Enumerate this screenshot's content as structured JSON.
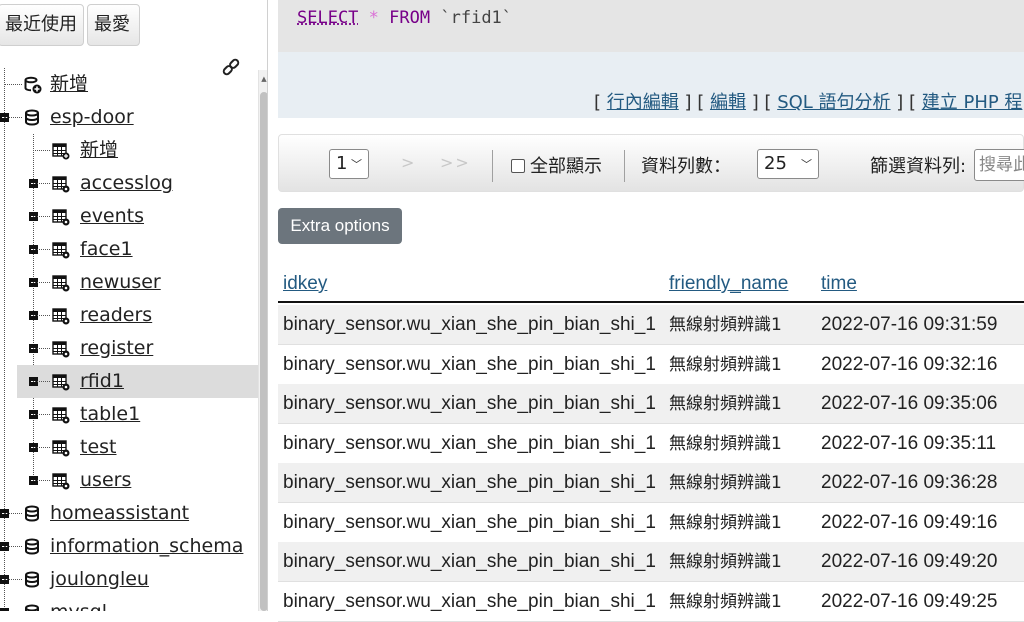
{
  "nav": {
    "recent_label": "最近使用",
    "favorites_label": "最愛",
    "tree": [
      {
        "label": "新增",
        "type": "new-db",
        "level": 0
      },
      {
        "label": "esp-door",
        "type": "db",
        "level": 0,
        "expanded": true
      },
      {
        "label": "新增",
        "type": "new-table",
        "level": 1
      },
      {
        "label": "accesslog",
        "type": "table",
        "level": 1
      },
      {
        "label": "events",
        "type": "table",
        "level": 1
      },
      {
        "label": "face1",
        "type": "table",
        "level": 1
      },
      {
        "label": "newuser",
        "type": "table",
        "level": 1
      },
      {
        "label": "readers",
        "type": "table",
        "level": 1
      },
      {
        "label": "register",
        "type": "table",
        "level": 1
      },
      {
        "label": "rfid1",
        "type": "table",
        "level": 1,
        "selected": true
      },
      {
        "label": "table1",
        "type": "table",
        "level": 1
      },
      {
        "label": "test",
        "type": "table",
        "level": 1
      },
      {
        "label": "users",
        "type": "table",
        "level": 1
      },
      {
        "label": "homeassistant",
        "type": "db",
        "level": 0
      },
      {
        "label": "information_schema",
        "type": "db",
        "level": 0
      },
      {
        "label": "joulongleu",
        "type": "db",
        "level": 0
      },
      {
        "label": "mysql",
        "type": "db",
        "level": 0
      }
    ]
  },
  "sql": {
    "kw_select": "SELECT",
    "star": "*",
    "kw_from": "FROM",
    "table": "`rfid1`",
    "links": {
      "inline_edit": "行內編輯",
      "edit": "編輯",
      "sql_analyze": "SQL 語句分析",
      "create_php": "建立 PHP 程"
    }
  },
  "pager": {
    "page_value": "1",
    "next": ">",
    "last": ">>",
    "show_all": "全部顯示",
    "rows_label": "資料列數：",
    "rows_value": "25",
    "filter_label": "篩選資料列:",
    "filter_placeholder": "搜尋此"
  },
  "extra_options_label": "Extra options",
  "table": {
    "columns": [
      "idkey",
      "friendly_name",
      "time"
    ],
    "rows": [
      [
        "binary_sensor.wu_xian_she_pin_bian_shi_1",
        "無線射頻辨識1",
        "2022-07-16 09:31:59"
      ],
      [
        "binary_sensor.wu_xian_she_pin_bian_shi_1",
        "無線射頻辨識1",
        "2022-07-16 09:32:16"
      ],
      [
        "binary_sensor.wu_xian_she_pin_bian_shi_1",
        "無線射頻辨識1",
        "2022-07-16 09:35:06"
      ],
      [
        "binary_sensor.wu_xian_she_pin_bian_shi_1",
        "無線射頻辨識1",
        "2022-07-16 09:35:11"
      ],
      [
        "binary_sensor.wu_xian_she_pin_bian_shi_1",
        "無線射頻辨識1",
        "2022-07-16 09:36:28"
      ],
      [
        "binary_sensor.wu_xian_she_pin_bian_shi_1",
        "無線射頻辨識1",
        "2022-07-16 09:49:16"
      ],
      [
        "binary_sensor.wu_xian_she_pin_bian_shi_1",
        "無線射頻辨識1",
        "2022-07-16 09:49:20"
      ],
      [
        "binary_sensor.wu_xian_she_pin_bian_shi_1",
        "無線射頻辨識1",
        "2022-07-16 09:49:25"
      ]
    ]
  },
  "colors": {
    "link": "#235a81",
    "selected_row": "#dcdcdc",
    "button_gray": "#6c757d"
  }
}
